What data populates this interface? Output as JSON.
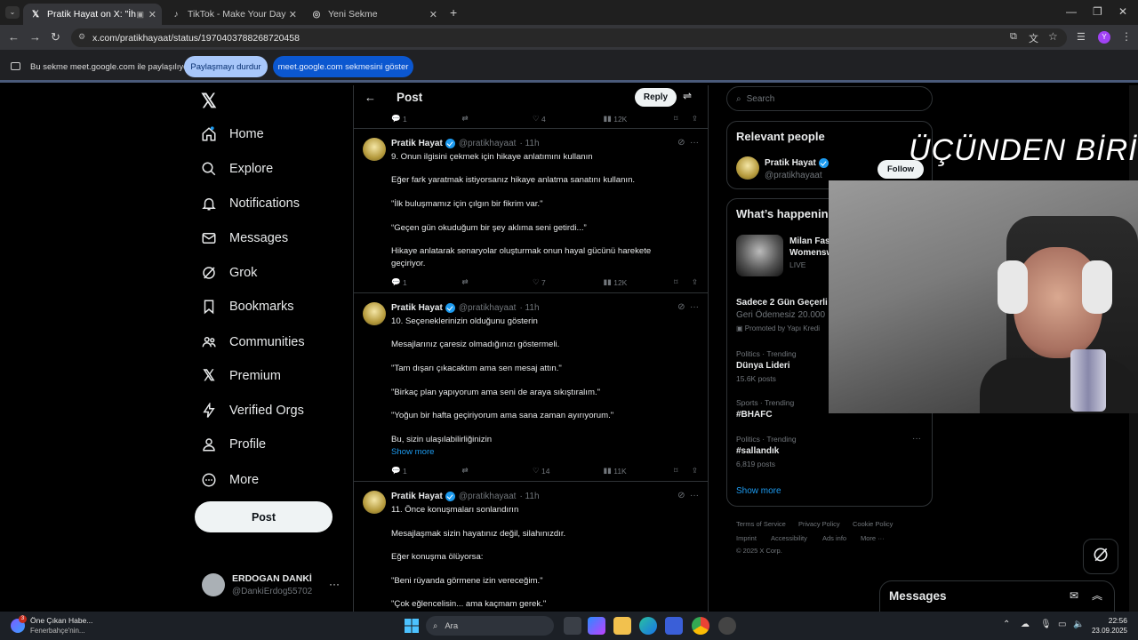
{
  "browser": {
    "tabs": [
      {
        "title": "Pratik Hayat on X: \"İhtiyaç...",
        "active": true
      },
      {
        "title": "TikTok - Make Your Day",
        "active": false
      },
      {
        "title": "Yeni Sekme",
        "active": false
      }
    ],
    "url": "x.com/pratikhayaat/status/1970403788268720458",
    "share_text": "Bu sekme meet.google.com ile paylaşılıyor",
    "stop_sharing": "Paylaşmayı durdur",
    "show_tab": "meet.google.com sekmesini göster"
  },
  "sidebar": {
    "items": [
      {
        "label": "Home",
        "icon": "home-icon"
      },
      {
        "label": "Explore",
        "icon": "search-icon"
      },
      {
        "label": "Notifications",
        "icon": "bell-icon"
      },
      {
        "label": "Messages",
        "icon": "mail-icon"
      },
      {
        "label": "Grok",
        "icon": "grok-icon"
      },
      {
        "label": "Bookmarks",
        "icon": "bookmark-icon"
      },
      {
        "label": "Communities",
        "icon": "communities-icon"
      },
      {
        "label": "Premium",
        "icon": "x-logo-icon"
      },
      {
        "label": "Verified Orgs",
        "icon": "lightning-icon"
      },
      {
        "label": "Profile",
        "icon": "person-icon"
      },
      {
        "label": "More",
        "icon": "more-circle-icon"
      }
    ],
    "post_button": "Post",
    "account": {
      "name": "ERDOGAN DANKİ",
      "handle": "@DankiErdog55702"
    }
  },
  "header": {
    "title": "Post",
    "reply_button": "Reply"
  },
  "top_stats": {
    "replies": "1",
    "likes": "4",
    "views": "12K"
  },
  "tweets": [
    {
      "name": "Pratik Hayat",
      "handle": "@pratikhayaat",
      "time": "· 11h",
      "lines": [
        "9. Onun ilgisini çekmek için hikaye anlatımını kullanın",
        "Eğer fark yaratmak istiyorsanız hikaye anlatma sanatını kullanın.",
        "\"İlk buluşmamız için çılgın bir fikrim var.\"",
        "“Geçen gün okuduğum bir şey aklıma seni getirdi...”",
        "Hikaye anlatarak senaryolar oluşturmak onun hayal gücünü harekete",
        "geçiriyor."
      ],
      "replies": "1",
      "likes": "7",
      "views": "12K"
    },
    {
      "name": "Pratik Hayat",
      "handle": "@pratikhayaat",
      "time": "· 11h",
      "lines": [
        "10. Seçeneklerinizin olduğunu gösterin",
        "Mesajlarınız çaresiz olmadığınızı göstermeli.",
        "\"Tam dışarı çıkacaktım ama sen mesaj attın.\"",
        "\"Birkaç plan yapıyorum ama seni de araya sıkıştıralım.\"",
        "\"Yoğun bir hafta geçiriyorum ama sana zaman ayırıyorum.\"",
        "Bu, sizin ulaşılabilirliğinizin"
      ],
      "show_more": "Show more",
      "replies": "1",
      "likes": "14",
      "views": "11K"
    },
    {
      "name": "Pratik Hayat",
      "handle": "@pratikhayaat",
      "time": "· 11h",
      "lines": [
        "11. Önce konuşmaları sonlandırın",
        "Mesajlaşmak sizin hayatınız değil, silahınızdır.",
        "Eğer konuşma ölüyorsa:",
        "\"Beni rüyanda görmene izin vereceğim.\"",
        "\"Çok eğlencelisin... ama kaçmam gerek.\""
      ]
    }
  ],
  "right": {
    "search_placeholder": "Search",
    "relevant_title": "Relevant people",
    "relevant_name": "Pratik Hayat",
    "relevant_handle": "@pratikhayaat",
    "follow": "Follow",
    "happening_title": "What’s happenin",
    "event_title1": "Milan Fas",
    "event_title2": "Womensw",
    "event_live": "LIVE",
    "promo_title": "Sadece 2 Gün Geçerli",
    "promo_sub": "Geri Ödemesiz 20.000",
    "promo_by": "Promoted by Yapı Kredi",
    "trends": [
      {
        "cat": "Politics · Trending",
        "name": "Dünya Lideri",
        "count": "15.6K posts"
      },
      {
        "cat": "Sports · Trending",
        "name": "#BHAFC",
        "count": ""
      },
      {
        "cat": "Politics · Trending",
        "name": "#sallandık",
        "count": "6,819 posts"
      }
    ],
    "show_more": "Show more",
    "footer": [
      "Terms of Service",
      "Privacy Policy",
      "Cookie Policy",
      "Imprint",
      "Accessibility",
      "Ads info",
      "More ···",
      "© 2025 X Corp."
    ],
    "messages": "Messages"
  },
  "overlay_text": "ÜÇÜNDEN BİRİ",
  "taskbar": {
    "news_title": "Öne Çıkan Habe...",
    "news_sub": "Fenerbahçe'nin...",
    "search": "Ara",
    "time": "22:56",
    "date": "23.09.2025"
  },
  "colors": {
    "accent": "#1d9bf0",
    "share_pill": "#a8c7fa",
    "share_pill2": "#0b57d0"
  }
}
